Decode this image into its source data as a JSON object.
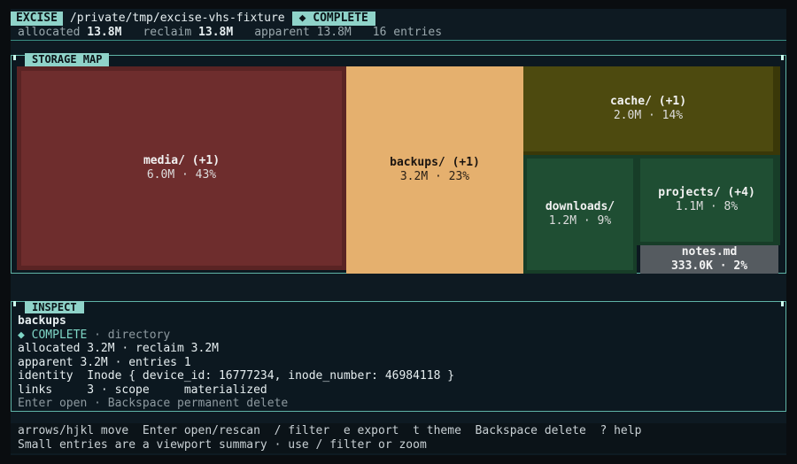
{
  "header": {
    "app_tag": "EXCISE",
    "path": "/private/tmp/excise-vhs-fixture",
    "status": "◆ COMPLETE",
    "allocated_label": "allocated",
    "allocated_value": "13.8M",
    "reclaim_label": "reclaim",
    "reclaim_value": "13.8M",
    "apparent": "apparent 13.8M",
    "entries": "16 entries"
  },
  "storage_map": {
    "title": "STORAGE MAP",
    "tiles": [
      {
        "name": "media/ (+1)",
        "size": "6.0M · 43%",
        "color": "#6e2d2d"
      },
      {
        "name": "backups/ (+1)",
        "size": "3.2M · 23%",
        "color": "#e5b06e"
      },
      {
        "name": "cache/ (+1)",
        "size": "2.0M · 14%",
        "color": "#4d4a0f"
      },
      {
        "name": "downloads/",
        "size": "1.2M · 9%",
        "color": "#1f4e33"
      },
      {
        "name": "projects/ (+4)",
        "size": "1.1M · 8%",
        "color": "#1f4e33"
      },
      {
        "name": "notes.md",
        "size": "333.0K · 2%",
        "color": "#555b60"
      }
    ]
  },
  "inspect": {
    "title": "INSPECT",
    "name": "backups",
    "status": "◆ COMPLETE",
    "kind": " · directory",
    "line_alloc": "allocated 3.2M · reclaim 3.2M",
    "line_apparent": "apparent 3.2M · entries 1",
    "line_identity": "identity  Inode { device_id: 16777234, inode_number: 46984118 }",
    "line_links": "links     3 · scope     materialized",
    "line_hint": "Enter open · Backspace permanent delete"
  },
  "footer": {
    "keys": "arrows/hjkl move  Enter open/rescan  / filter  e export  t theme  Backspace delete  ? help",
    "note": "Small entries are a viewport summary · use / filter or zoom"
  }
}
